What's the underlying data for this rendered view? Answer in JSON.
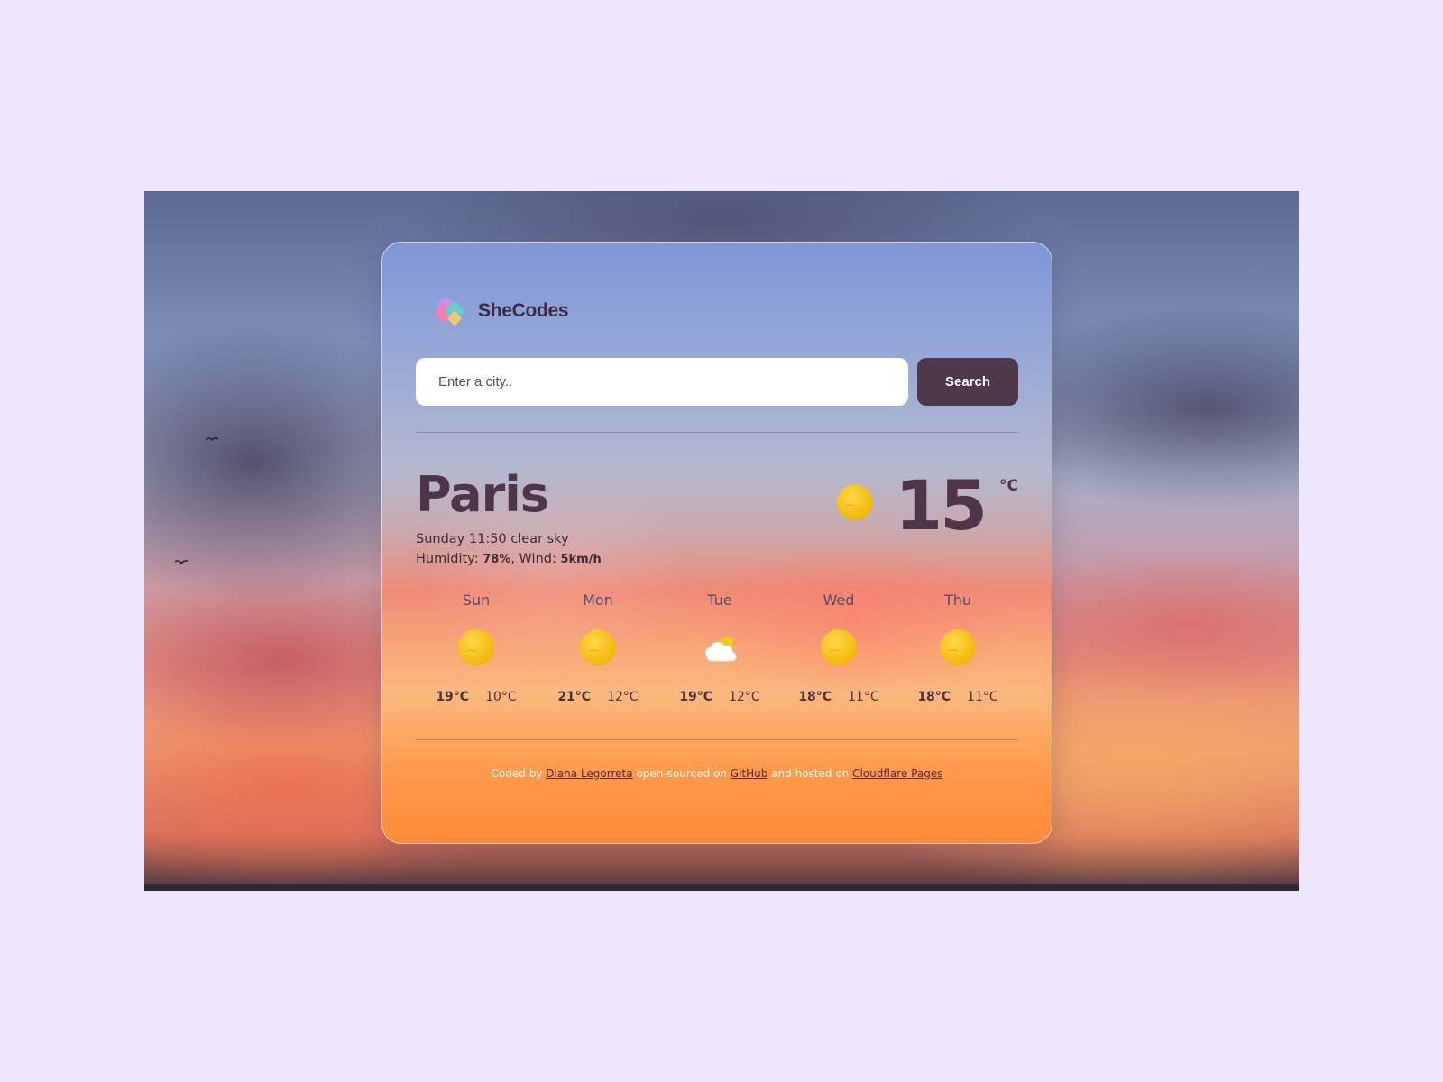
{
  "brand": {
    "name": "SheCodes"
  },
  "search": {
    "placeholder": "Enter a city..",
    "button_label": "Search"
  },
  "current": {
    "city": "Paris",
    "day": "Sunday",
    "time": "11:50",
    "description": "clear sky",
    "humidity_label": "Humidity:",
    "humidity_value": "78%",
    "wind_label": "Wind:",
    "wind_value": "5km/h",
    "temperature": "15",
    "unit": "°C",
    "icon": "sun-icon"
  },
  "forecast": [
    {
      "day": "Sun",
      "icon": "sun-icon",
      "max": "19°C",
      "min": "10°C"
    },
    {
      "day": "Mon",
      "icon": "sun-icon",
      "max": "21°C",
      "min": "12°C"
    },
    {
      "day": "Tue",
      "icon": "cloud-sun-icon",
      "max": "19°C",
      "min": "12°C"
    },
    {
      "day": "Wed",
      "icon": "sun-icon",
      "max": "18°C",
      "min": "11°C"
    },
    {
      "day": "Thu",
      "icon": "sun-icon",
      "max": "18°C",
      "min": "11°C"
    }
  ],
  "footer": {
    "coded_by": "Coded by",
    "author_link": "Diana Legorreta",
    "open_sourced": "open-sourced on",
    "github_link": "GitHub",
    "hosted": "and hosted on",
    "host_link": "Cloudflare Pages"
  },
  "colors": {
    "page_background": "#ede6fe",
    "accent_dark": "#4e3849",
    "sun": "#f5c518"
  }
}
